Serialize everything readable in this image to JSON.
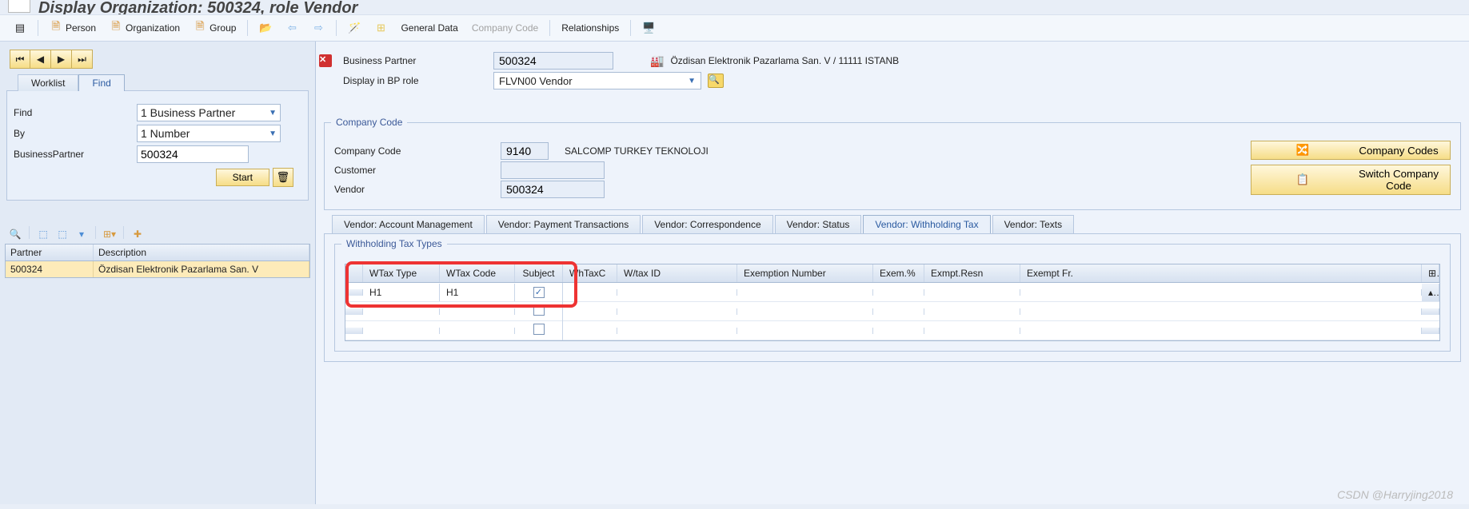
{
  "title": "Display Organization: 500324, role Vendor",
  "toolbar": {
    "person": "Person",
    "organization": "Organization",
    "group": "Group",
    "general_data": "General Data",
    "company_code": "Company Code",
    "relationships": "Relationships"
  },
  "left": {
    "tabs": {
      "worklist": "Worklist",
      "find": "Find"
    },
    "find_label": "Find",
    "find_value": "1 Business Partner",
    "by_label": "By",
    "by_value": "1 Number",
    "bp_label": "BusinessPartner",
    "bp_value": "500324",
    "start": "Start",
    "grid": {
      "col_partner": "Partner",
      "col_desc": "Description",
      "row_partner": "500324",
      "row_desc": "Özdisan Elektronik Pazarlama San. V"
    }
  },
  "right": {
    "bp_label": "Business Partner",
    "bp_value": "500324",
    "bp_text": "Özdisan Elektronik Pazarlama San. V / 11111 ISTANB",
    "role_label": "Display in BP role",
    "role_value": "FLVN00 Vendor",
    "cc_group": "Company Code",
    "cc_label": "Company Code",
    "cc_value": "9140",
    "cc_text": "SALCOMP TURKEY TEKNOLOJI",
    "customer_label": "Customer",
    "customer_value": "",
    "vendor_label": "Vendor",
    "vendor_value": "500324",
    "btn_cc": "Company Codes",
    "btn_switch": "Switch Company Code",
    "tabs": {
      "t1": "Vendor: Account Management",
      "t2": "Vendor: Payment Transactions",
      "t3": "Vendor: Correspondence",
      "t4": "Vendor: Status",
      "t5": "Vendor: Withholding Tax",
      "t6": "Vendor: Texts"
    },
    "wt_group": "Withholding Tax Types",
    "wt_cols": {
      "c1": "WTax Type",
      "c2": "WTax Code",
      "c3": "Subject",
      "c4": "WhTaxC",
      "c5": "W/tax ID",
      "c6": "Exemption Number",
      "c7": "Exem.%",
      "c8": "Exmpt.Resn",
      "c9": "Exempt Fr."
    },
    "wt_rows": [
      {
        "type": "H1",
        "code": "H1",
        "subject": true
      },
      {
        "type": "",
        "code": "",
        "subject": false
      },
      {
        "type": "",
        "code": "",
        "subject": false
      }
    ]
  },
  "watermark": "CSDN @Harryjing2018"
}
